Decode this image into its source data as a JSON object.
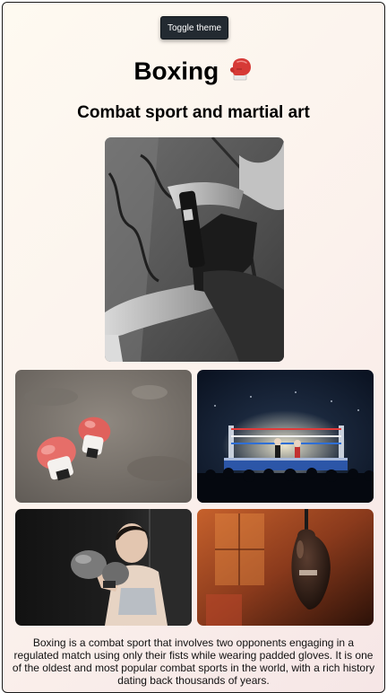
{
  "header": {
    "toggle_label": "Toggle theme",
    "title": "Boxing",
    "title_emoji": "boxing-glove-icon",
    "subtitle": "Combat sport and martial art"
  },
  "gallery": {
    "images": [
      {
        "name": "hand-wrapping-photo",
        "subject": "hands being wrapped with black wraps"
      },
      {
        "name": "boxing-gloves-photo",
        "subject": "pair of red and white boxing gloves on concrete floor"
      },
      {
        "name": "boxing-ring-photo",
        "subject": "boxing ring under lights in dark arena"
      },
      {
        "name": "woman-boxer-photo",
        "subject": "woman in grey gloves in guard stance"
      },
      {
        "name": "punching-bag-photo",
        "subject": "speed bag hanging against orange window light"
      }
    ]
  },
  "description": "Boxing is a combat sport that involves two opponents engaging in a regulated match using only their fists while wearing padded gloves. It is one of the oldest and most popular combat sports in the world, with a rich history dating back thousands of years.",
  "colors": {
    "button_bg": "#232a31",
    "page_gradient_start": "#fefaf1",
    "page_gradient_end": "#f6e6e6",
    "glove_red": "#d63a36"
  }
}
